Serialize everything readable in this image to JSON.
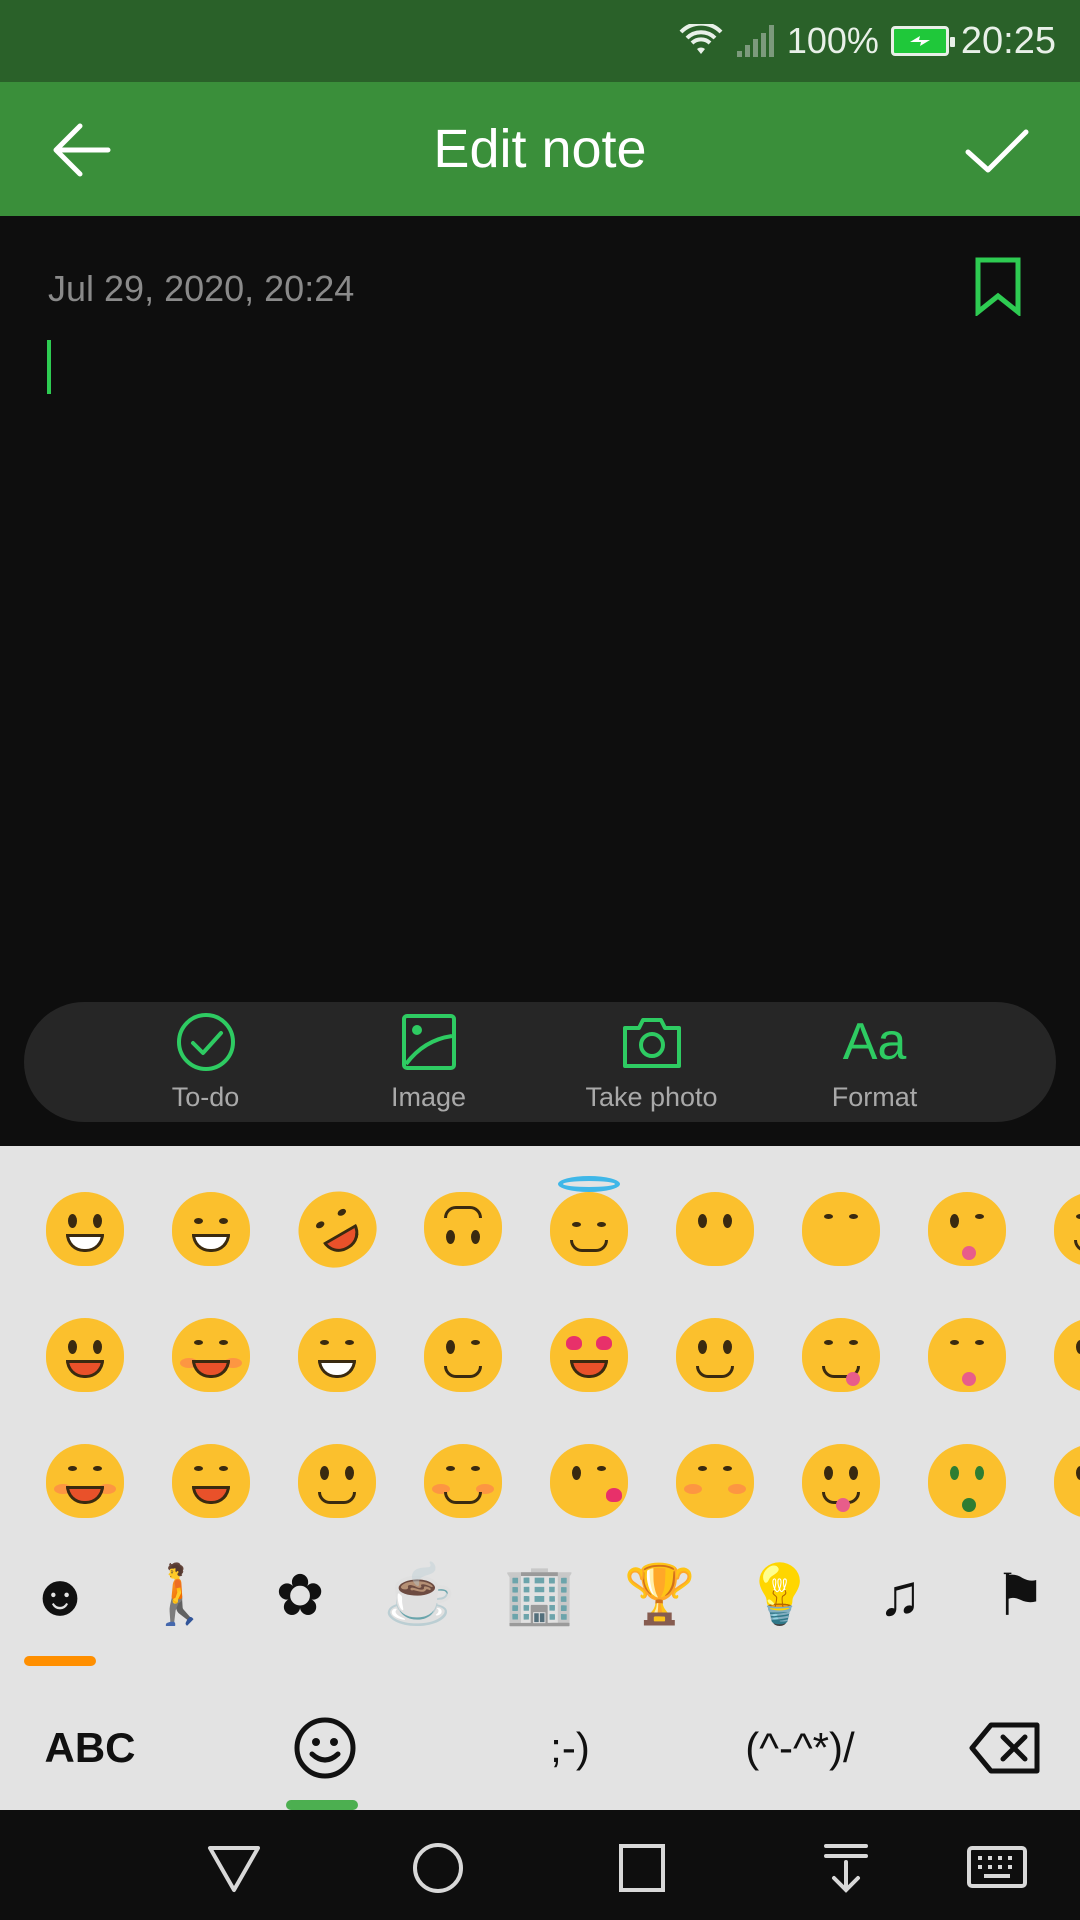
{
  "status_bar": {
    "battery_percent": "100%",
    "time": "20:25",
    "icons": [
      "wifi-icon",
      "signal-icon",
      "battery-charging-icon"
    ]
  },
  "app_bar": {
    "title": "Edit note",
    "back_icon": "arrow-left-icon",
    "confirm_icon": "check-icon"
  },
  "editor": {
    "date": "Jul 29, 2020, 20:24",
    "bookmark_icon": "bookmark-icon",
    "note_text": ""
  },
  "toolbar": {
    "items": [
      {
        "label": "To-do",
        "icon": "todo-check-icon"
      },
      {
        "label": "Image",
        "icon": "image-icon"
      },
      {
        "label": "Take photo",
        "icon": "camera-icon"
      },
      {
        "label": "Format",
        "icon": "format-icon",
        "glyph": "Aa"
      }
    ]
  },
  "emoji_keyboard": {
    "rows": [
      [
        "grinning",
        "beaming",
        "rolling-laughing",
        "upside-down",
        "halo",
        "kissing",
        "kissing-smiling-eyes",
        "winking-tongue",
        "hugging"
      ],
      [
        "smiley",
        "squinting-laugh",
        "tears-of-joy",
        "winking",
        "heart-eyes",
        "slightly-smiling",
        "savoring-food",
        "squinting-tongue",
        "thinking"
      ],
      [
        "smile-blush",
        "sweat-smile",
        "slight-smile",
        "blush",
        "kissing-heart",
        "kissing-closed-eyes",
        "tongue-out",
        "money-mouth",
        "zipper-mouth"
      ]
    ],
    "categories": [
      "smileys-icon",
      "people-icon",
      "nature-icon",
      "food-icon",
      "travel-icon",
      "activity-icon",
      "objects-icon",
      "symbols-icon",
      "flags-icon"
    ],
    "category_glyphs": [
      "☻",
      "🚶",
      "✿",
      "☕",
      "🏢",
      "🏆",
      "💡",
      "♫",
      "⚑"
    ],
    "bottom_row": {
      "abc_label": "ABC",
      "emoji_icon": "emoji-smiley-icon",
      "emoticon_label": ";-)",
      "kaomoji_label": "(^-^*)/",
      "backspace_icon": "backspace-icon"
    },
    "colors": {
      "active_category": "#ff8f00",
      "active_mode": "#4caf50"
    }
  },
  "nav_bar": {
    "icons": [
      "back-triangle-icon",
      "home-circle-icon",
      "recents-square-icon",
      "notification-pull-icon",
      "keyboard-icon"
    ]
  },
  "colors": {
    "status_bar": "#2a6129",
    "app_bar": "#3a8f3a",
    "accent": "#2ecb52"
  }
}
